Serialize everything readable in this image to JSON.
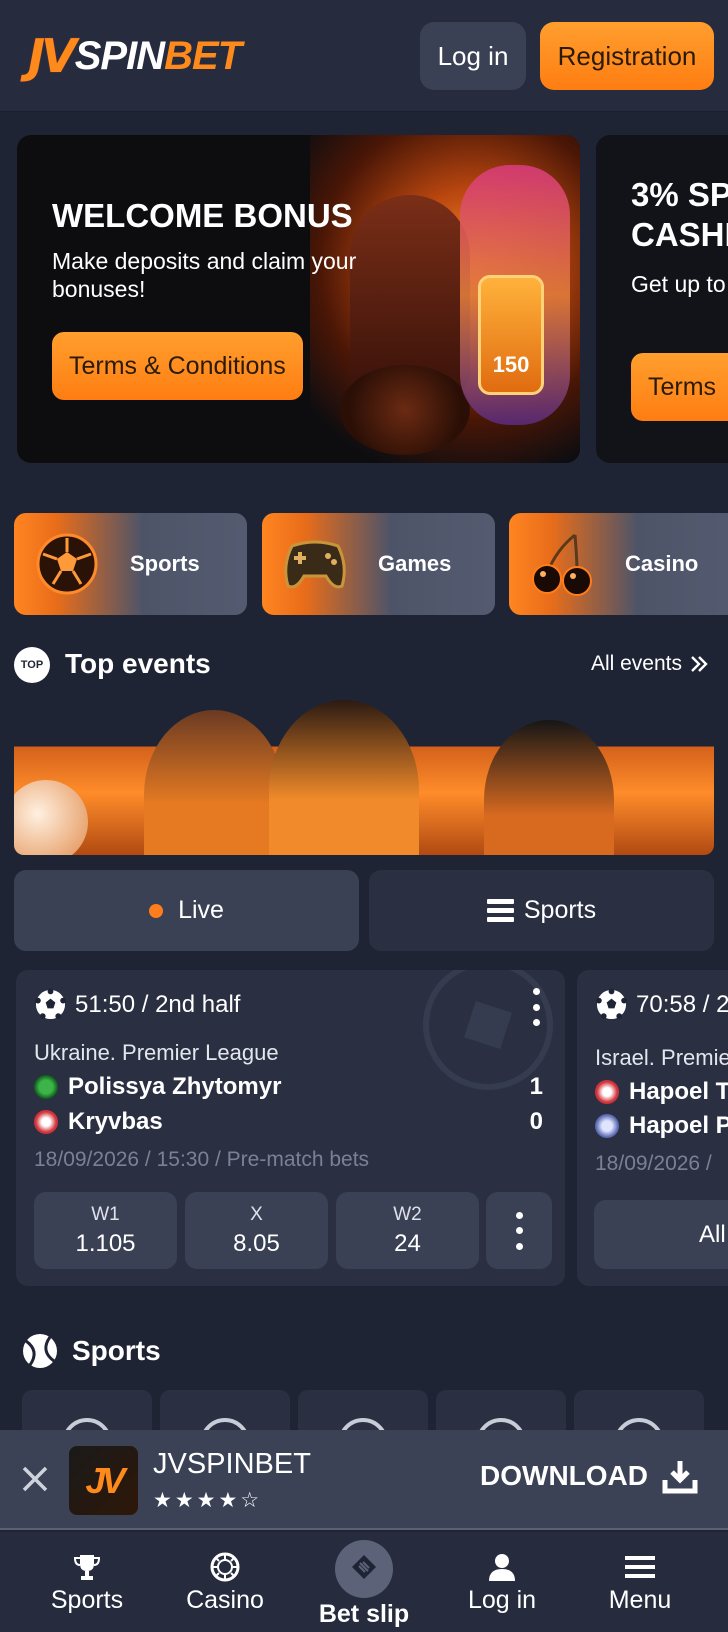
{
  "header": {
    "logo_mark": "JV",
    "logo_text_1": "SPIN",
    "logo_text_2": "BET",
    "login_label": "Log in",
    "registration_label": "Registration"
  },
  "banners": [
    {
      "title": "WELCOME BONUS",
      "subtitle": "Make deposits and claim your bonuses!",
      "button": "Terms & Conditions",
      "phone_badge": "150"
    },
    {
      "title": "3% SP CASHI",
      "subtitle": "Get up to week!",
      "button": "Terms"
    }
  ],
  "categories": [
    {
      "label": "Sports",
      "icon": "soccer-ball-icon"
    },
    {
      "label": "Games",
      "icon": "gamepad-icon"
    },
    {
      "label": "Casino",
      "icon": "cherries-icon"
    }
  ],
  "top_events": {
    "badge": "TOP",
    "title": "Top events",
    "all_events": "All events"
  },
  "tabs": {
    "live": "Live",
    "sports": "Sports"
  },
  "events": [
    {
      "time": "51:50 / 2nd half",
      "league": "Ukraine. Premier League",
      "team1": "Polissya Zhytomyr",
      "team2": "Kryvbas",
      "score1": "1",
      "score2": "0",
      "date": "18/09/2026 / 15:30 / Pre-match bets",
      "odds": [
        {
          "label": "W1",
          "value": "1.105"
        },
        {
          "label": "X",
          "value": "8.05"
        },
        {
          "label": "W2",
          "value": "24"
        }
      ]
    },
    {
      "time": "70:58 / 2",
      "league": "Israel. Premie",
      "team1": "Hapoel T",
      "team2": "Hapoel P",
      "date": "18/09/2026 /",
      "all_label": "All"
    }
  ],
  "sports_section": {
    "title": "Sports"
  },
  "app_banner": {
    "name": "JVSPINBET",
    "logo_mark": "JV",
    "stars": "★★★★☆",
    "rating": 4.5,
    "download": "DOWNLOAD"
  },
  "bottom_nav": [
    {
      "label": "Sports",
      "icon": "trophy-icon"
    },
    {
      "label": "Casino",
      "icon": "chip-icon"
    },
    {
      "label": "Bet slip",
      "icon": "ticket-icon"
    },
    {
      "label": "Log in",
      "icon": "user-icon"
    },
    {
      "label": "Menu",
      "icon": "menu-icon"
    }
  ],
  "colors": {
    "accent": "#ff8a1c",
    "background": "#1f2434",
    "card": "#2a3042",
    "button": "#3a4154"
  }
}
